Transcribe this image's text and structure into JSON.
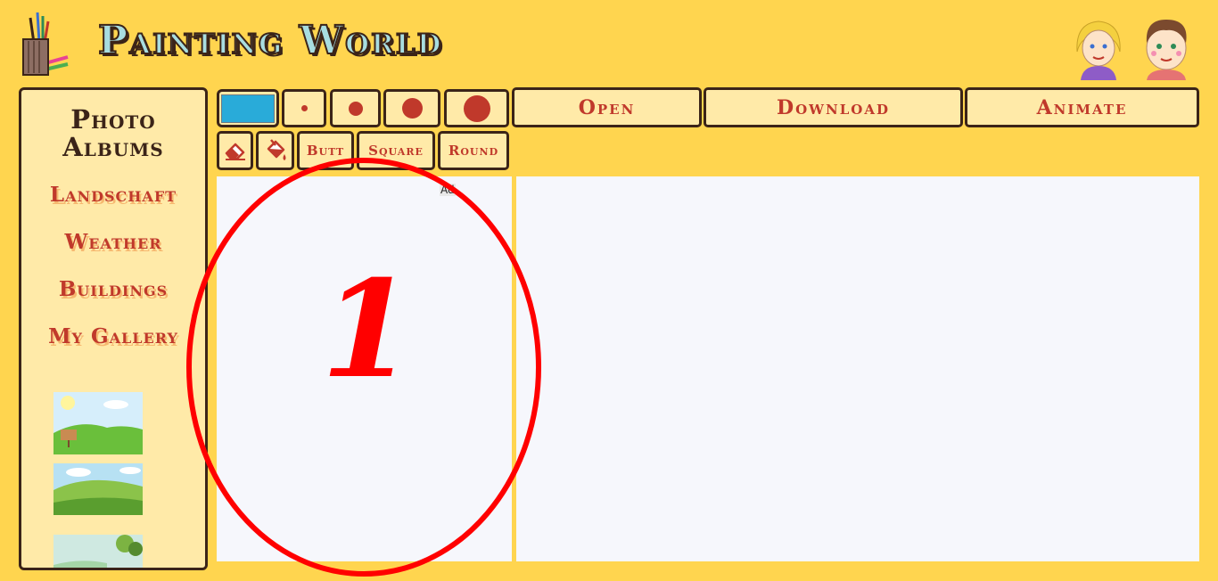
{
  "header": {
    "title": "Painting World"
  },
  "sidebar": {
    "title_line1": "Photo",
    "title_line2": "Albums",
    "albums": [
      {
        "label": "Landschaft"
      },
      {
        "label": "Weather"
      },
      {
        "label": "Buildings"
      },
      {
        "label": "My Gallery"
      }
    ]
  },
  "toolbar": {
    "current_color": "#29abd9",
    "brush_sizes": [
      "small",
      "medium",
      "large",
      "extra-large"
    ],
    "open_label": "Open",
    "download_label": "Download",
    "animate_label": "Animate",
    "line_caps": [
      "Butt",
      "Square",
      "Round"
    ]
  },
  "ad": {
    "label": "Ad"
  },
  "annotation": {
    "number": "1",
    "color": "#ff0000"
  },
  "colors": {
    "background": "#ffd54f",
    "panel": "#ffeaa8",
    "accent": "#c0392b",
    "border": "#3b2418",
    "canvas": "#f6f7fc"
  }
}
